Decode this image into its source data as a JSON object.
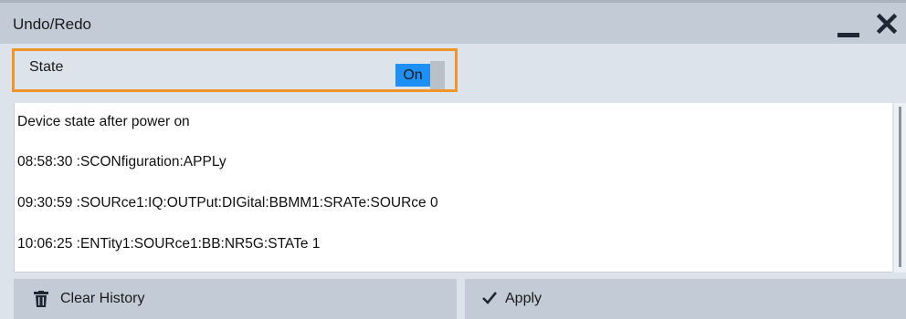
{
  "dialog": {
    "title": "Undo/Redo",
    "minimize_icon": "minimize-icon",
    "close_icon": "close-icon"
  },
  "state": {
    "label": "State",
    "toggle_value": "On",
    "accent_color": "#f0952a",
    "toggle_color": "#1e90f5"
  },
  "history": {
    "items": [
      "Device state after power on",
      "08:58:30 :SCONfiguration:APPLy",
      "09:30:59 :SOURce1:IQ:OUTPut:DIGital:BBMM1:SRATe:SOURce 0",
      "10:06:25 :ENTity1:SOURce1:BB:NR5G:STATe 1"
    ]
  },
  "buttons": {
    "clear_label": "Clear History",
    "clear_icon": "trash-icon",
    "apply_label": "Apply",
    "apply_icon": "checkmark-icon"
  }
}
